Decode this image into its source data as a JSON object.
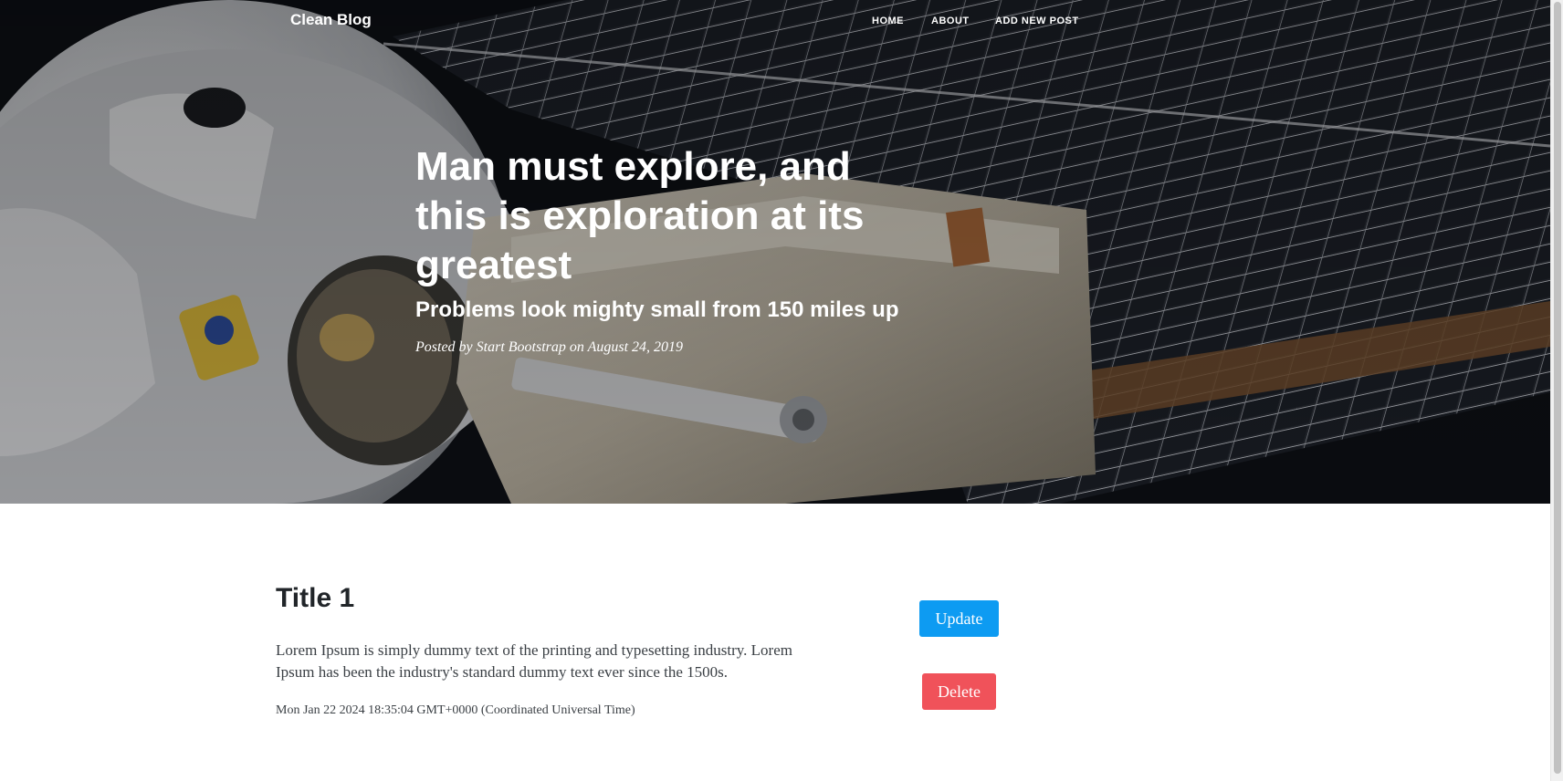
{
  "navbar": {
    "brand": "Clean Blog",
    "links": [
      "HOME",
      "ABOUT",
      "ADD NEW POST"
    ]
  },
  "header": {
    "title": "Man must explore, and this is exploration at its greatest",
    "subtitle": "Problems look mighty small from 150 miles up",
    "meta": "Posted by Start Bootstrap on August 24, 2019"
  },
  "post": {
    "title": "Title 1",
    "excerpt": "Lorem Ipsum is simply dummy text of the printing and typesetting industry. Lorem Ipsum has been the industry's standard dummy text ever since the 1500s.",
    "date": "Mon Jan 22 2024 18:35:04 GMT+0000 (Coordinated Universal Time)",
    "update_label": "Update",
    "delete_label": "Delete"
  },
  "colors": {
    "update_button": "#0d9bf2",
    "delete_button": "#f0525a",
    "heading_text": "#ffffff",
    "body_text": "#212529"
  },
  "icons": {
    "header_image": "astronaut-space-station-image"
  }
}
